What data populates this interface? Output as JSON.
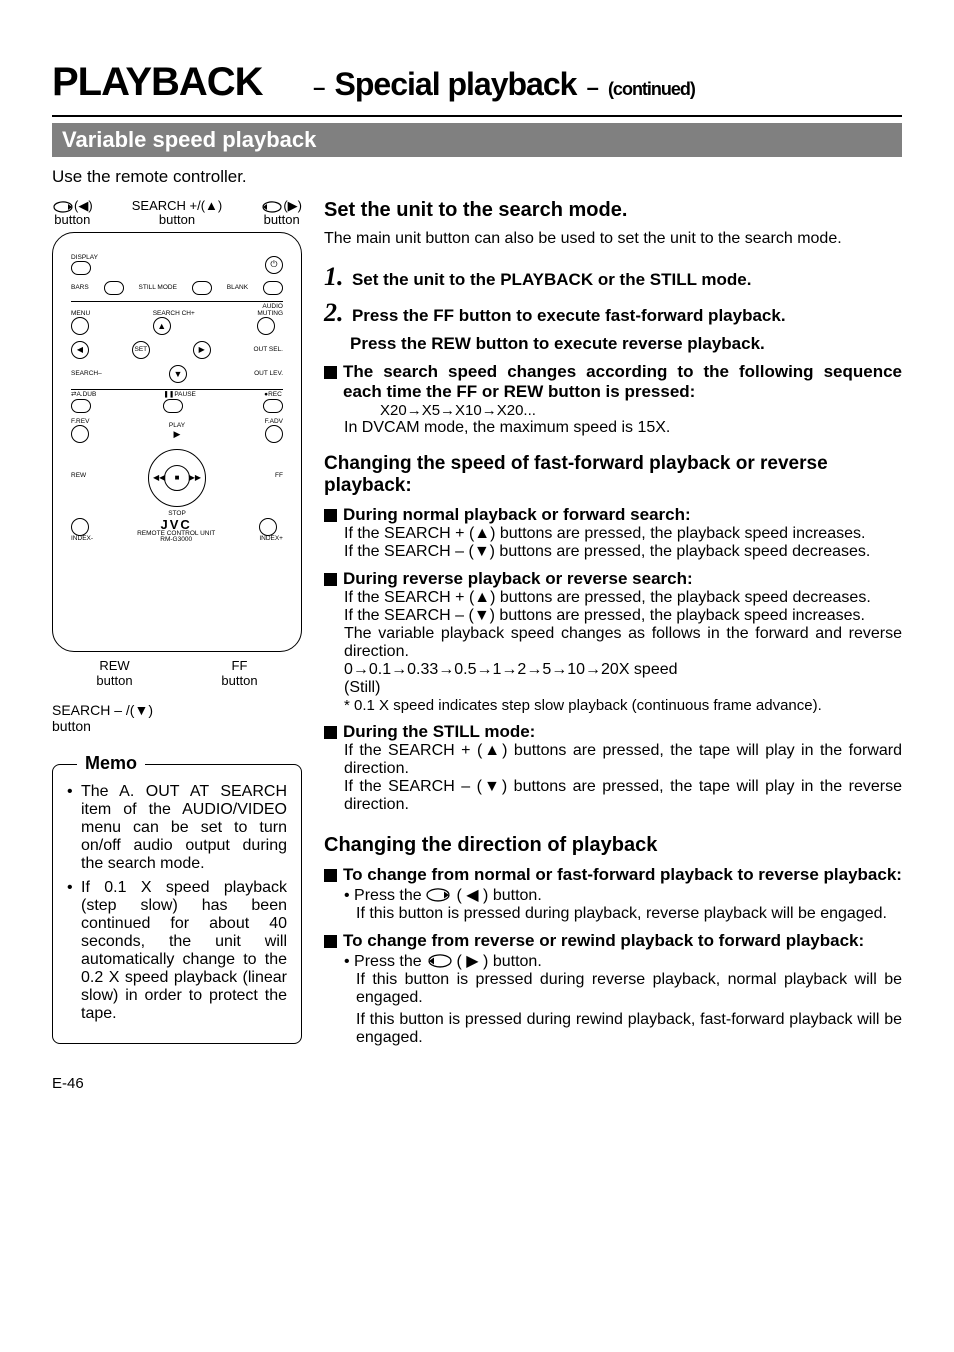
{
  "title": {
    "main": "PLAYBACK",
    "sep1": "–",
    "sub": "Special playback",
    "sep2": "–",
    "cont": "(continued)"
  },
  "sectionBar": "Variable speed playback",
  "intro": "Use the remote controller.",
  "remoteLabels": {
    "left": {
      "icon": "(◀)",
      "name": "button"
    },
    "mid": {
      "name1": "SEARCH +/(▲)",
      "name2": "button"
    },
    "right": {
      "icon": "(▶)",
      "name": "button"
    }
  },
  "remote": {
    "display": "DISPLAY",
    "bars": "BARS",
    "stillmode": "STILL MODE",
    "blank": "BLANK",
    "audio": "AUDIO",
    "menu": "MENU",
    "search": "SEARCH",
    "chplus": "CH+",
    "muting": "MUTING",
    "set": "SET",
    "outsel": "OUT SEL.",
    "searchminus": "SEARCH–",
    "outlev": "OUT LEV.",
    "adub": "A.DUB",
    "pause": "PAUSE",
    "rec": "REC",
    "frev": "F.REV",
    "play": "PLAY",
    "fadv": "F.ADV",
    "rew": "REW",
    "ff": "FF",
    "stop": "STOP",
    "indexm": "INDEX-",
    "indexp": "INDEX+",
    "logo": "JVC",
    "unit1": "REMOTE CONTROL UNIT",
    "unit2": "RM-G3000"
  },
  "btmLabels": {
    "rew1": "REW",
    "rew2": "button",
    "ff1": "FF",
    "ff2": "button"
  },
  "searchMinus": {
    "l1": "SEARCH – /(▼)",
    "l2": "button"
  },
  "memo": {
    "title": "Memo",
    "b1": "The A. OUT AT SEARCH item of the AUDIO/VIDEO menu can be set to turn on/off audio output during the search mode.",
    "b2": "If 0.1 X speed playback (step slow) has been continued for about 40 seconds, the unit will automatically change to the 0.2 X speed playback (linear slow) in order to protect the tape."
  },
  "right": {
    "h1": "Set the unit to the search mode.",
    "p1": "The main unit button can also be used to set the unit to the search mode.",
    "s1": "Set the unit to the PLAYBACK or the STILL mode.",
    "s2a": "Press the FF button to execute fast-forward playback.",
    "s2b": "Press the REW button to execute reverse playback.",
    "blk1": "The search speed changes according to the following sequence each time the FF or REW button is pressed:",
    "seq": "X20→X5→X10→X20...",
    "dvcam": "In DVCAM mode, the maximum speed is 15X.",
    "h2": "Changing the speed of fast-forward playback or reverse playback:",
    "blk2t": "During normal playback or forward search:",
    "blk2a": "If the SEARCH + (▲) buttons are pressed, the playback speed increases.",
    "blk2b": "If the SEARCH – (▼) buttons are pressed, the playback speed decreases.",
    "blk3t": "During reverse playback or reverse search:",
    "blk3a": "If the SEARCH + (▲) buttons are pressed, the playback speed decreases.",
    "blk3b": "If the SEARCH – (▼) buttons are pressed, the playback speed increases.",
    "blk3c": "The variable playback speed changes as follows in the forward and reverse direction.",
    "blk3d": "0→0.1→0.33→0.5→1→2→5→10→20X speed",
    "blk3e": "(Still)",
    "blk3f": "* 0.1 X speed indicates step slow playback (continuous frame advance).",
    "blk4t": "During the STILL mode:",
    "blk4a": "If the SEARCH + (▲) buttons are pressed, the tape will play in the forward direction.",
    "blk4b": "If the SEARCH – (▼) buttons are pressed, the tape will play in the reverse direction.",
    "h3": "Changing the direction of playback",
    "blk5t": "To change from normal or fast-forward playback to reverse playback:",
    "blk5a_pre": "• Press the ",
    "blk5a_post": " ( ◀ ) button.",
    "blk5b": "If this button is pressed during playback, reverse playback will be engaged.",
    "blk6t": "To change from reverse or rewind playback to forward playback:",
    "blk6a_pre": "• Press the ",
    "blk6a_post": " ( ▶ ) button.",
    "blk6b": "If this button is pressed during reverse playback, normal playback will be engaged.",
    "blk6c": "If this button is pressed during rewind playback, fast-forward playback will be engaged."
  },
  "pageNum": "E-46"
}
